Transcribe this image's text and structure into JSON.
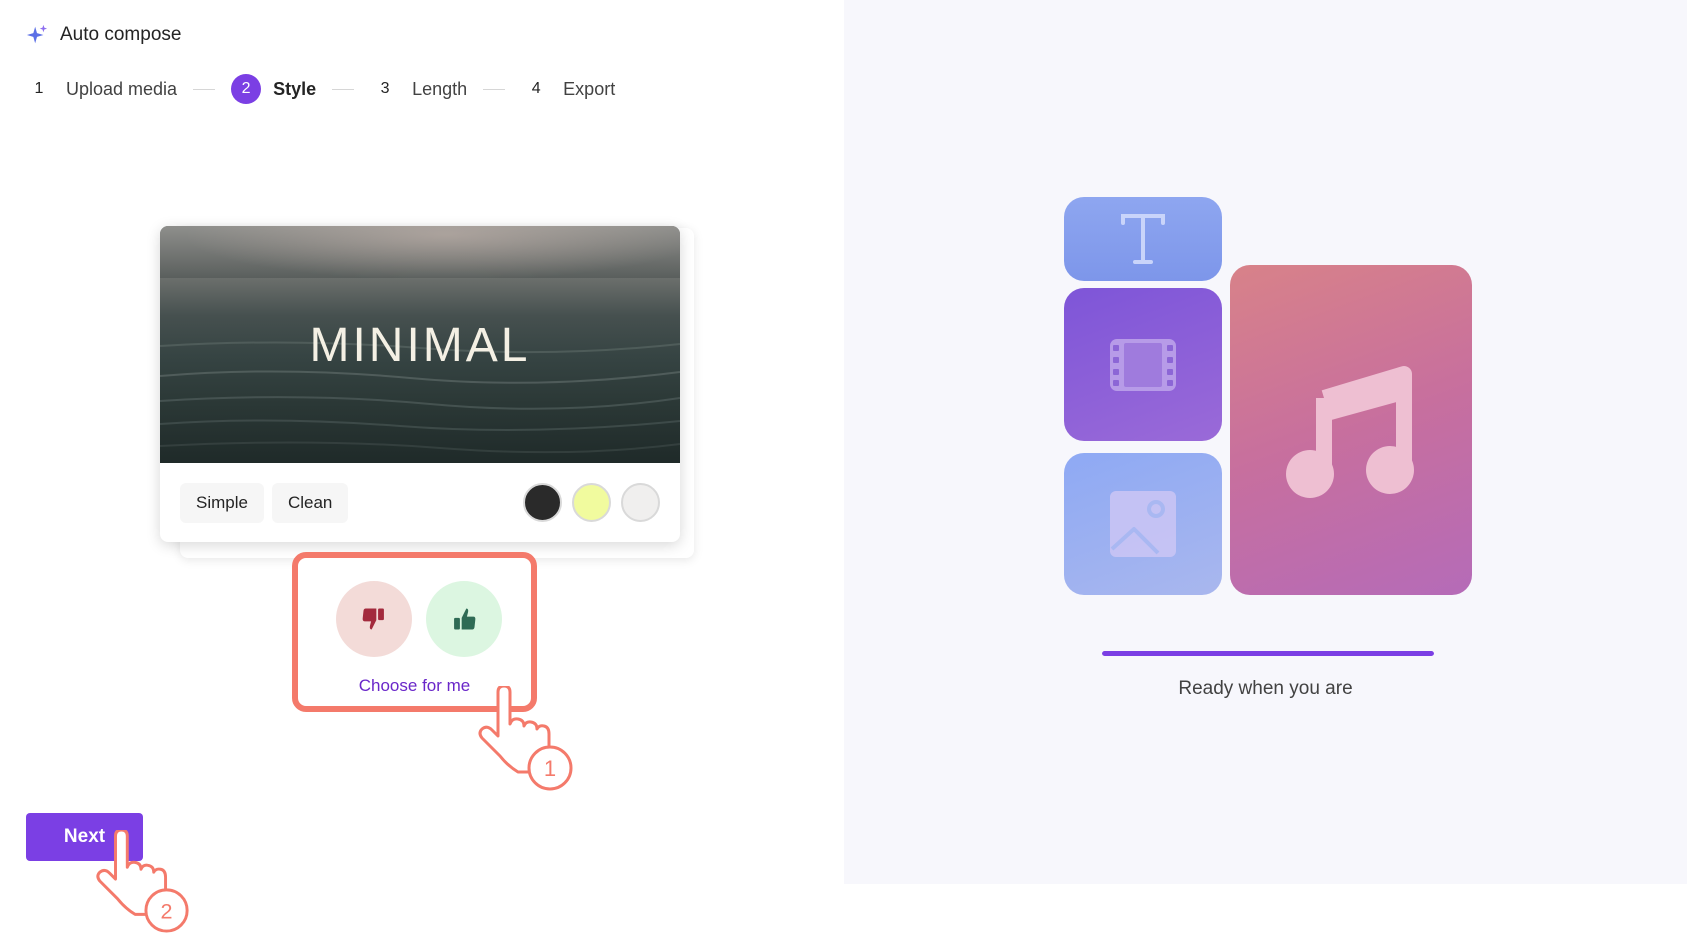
{
  "header": {
    "title": "Auto compose",
    "icon": "sparkle-icon"
  },
  "stepper": {
    "steps": [
      {
        "number": "1",
        "label": "Upload media",
        "active": false
      },
      {
        "number": "2",
        "label": "Style",
        "active": true
      },
      {
        "number": "3",
        "label": "Length",
        "active": false
      },
      {
        "number": "4",
        "label": "Export",
        "active": false
      }
    ]
  },
  "style_card": {
    "preview_title": "MINIMAL",
    "tags": [
      "Simple",
      "Clean"
    ],
    "swatches": [
      "#2a2a2a",
      "#f1fb9e",
      "#f0efee"
    ]
  },
  "feedback": {
    "dislike_icon": "thumbs-down-icon",
    "like_icon": "thumbs-up-icon",
    "choose_label": "Choose for me"
  },
  "annotations": {
    "step_1": "1",
    "step_2": "2"
  },
  "footer": {
    "next_label": "Next"
  },
  "right_panel": {
    "tiles": [
      "text-icon",
      "film-icon",
      "image-icon",
      "music-note-icon"
    ],
    "progress": 1.0,
    "status_text": "Ready when you are"
  },
  "colors": {
    "accent": "#7b3fe4",
    "highlight": "#f47a6b",
    "link": "#6a27c9"
  }
}
